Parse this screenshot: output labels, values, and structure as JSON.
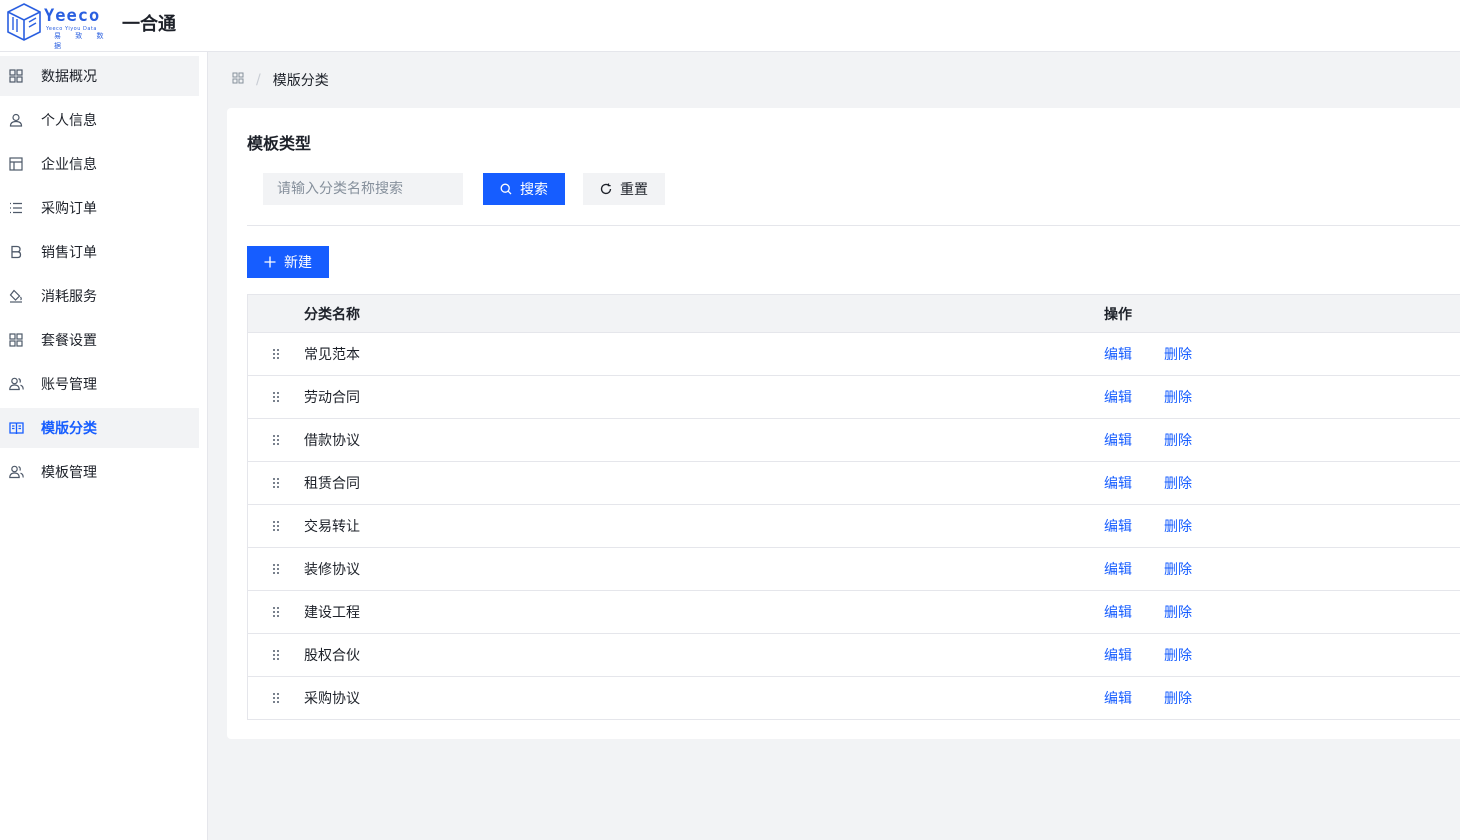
{
  "header": {
    "logo_text": "Yeeco",
    "logo_sub": "Yeeco Yiyou Data",
    "logo_cn": "易 致 数 据",
    "app_title": "一合通"
  },
  "sidebar": {
    "items": [
      {
        "label": "数据概况",
        "icon": "grid-icon"
      },
      {
        "label": "个人信息",
        "icon": "user-icon"
      },
      {
        "label": "企业信息",
        "icon": "layout-icon"
      },
      {
        "label": "采购订单",
        "icon": "list-icon"
      },
      {
        "label": "销售订单",
        "icon": "bold-b-icon"
      },
      {
        "label": "消耗服务",
        "icon": "paint-bucket-icon"
      },
      {
        "label": "套餐设置",
        "icon": "grid-icon"
      },
      {
        "label": "账号管理",
        "icon": "user-group-icon"
      },
      {
        "label": "模版分类",
        "icon": "book-icon"
      },
      {
        "label": "模板管理",
        "icon": "user-group-icon"
      }
    ]
  },
  "breadcrumb": {
    "current": "模版分类"
  },
  "card": {
    "title": "模板类型",
    "search_placeholder": "请输入分类名称搜索",
    "search_label": "搜索",
    "reset_label": "重置",
    "new_label": "新建"
  },
  "table": {
    "headers": {
      "name": "分类名称",
      "ops": "操作"
    },
    "edit_label": "编辑",
    "delete_label": "删除",
    "rows": [
      "常见范本",
      "劳动合同",
      "借款协议",
      "租赁合同",
      "交易转让",
      "装修协议",
      "建设工程",
      "股权合伙",
      "采购协议"
    ]
  },
  "colors": {
    "primary": "#165dff",
    "bg": "#f2f3f5",
    "border": "#e5e6eb"
  }
}
